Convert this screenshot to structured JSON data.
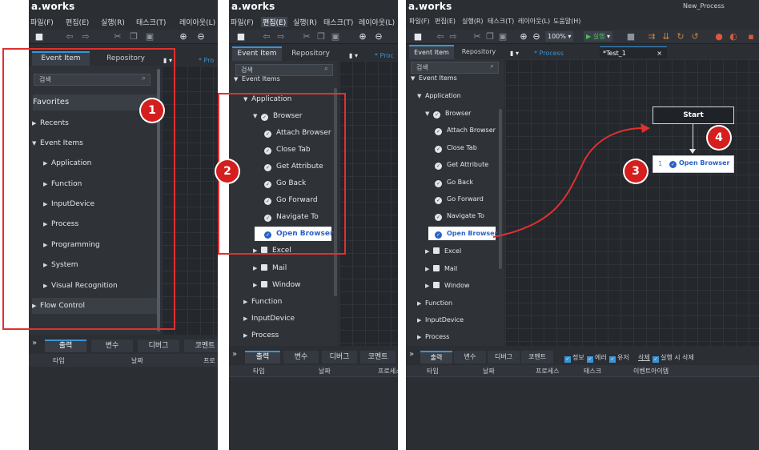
{
  "app": {
    "logo": "a.works",
    "window_title": "New_Process"
  },
  "menus": [
    "파일(F)",
    "편집(E)",
    "실행(R)",
    "태스크(T)",
    "레이아웃(L)",
    "도움말(H)"
  ],
  "toolbar": {
    "zoom": "100%",
    "run": "▶ 실행",
    "run_arrow": "▾"
  },
  "side_tabs": {
    "event_item": "Event Item",
    "repository": "Repository"
  },
  "search": {
    "placeholder": "검색",
    "icon": "search-icon"
  },
  "panel1_tree": {
    "favorites": "Favorites",
    "recents": "Recents",
    "event_items": "Event Items",
    "children": [
      "Application",
      "Function",
      "InputDevice",
      "Process",
      "Programming",
      "System",
      "Visual Recognition"
    ],
    "flow_control": "Flow Control"
  },
  "panel2_tree": {
    "event_items": "Event Items",
    "application": "Application",
    "browser": "Browser",
    "browser_items": [
      "Attach Browser",
      "Close Tab",
      "Get Attribute",
      "Go Back",
      "Go Forward",
      "Navigate To"
    ],
    "selected": "Open Browser",
    "after": [
      "Excel",
      "Mail",
      "Window"
    ],
    "roots": [
      "Function",
      "InputDevice",
      "Process"
    ]
  },
  "panel3_tree": {
    "event_items": "Event Items",
    "application": "Application",
    "browser": "Browser",
    "browser_items": [
      "Attach Browser",
      "Close Tab",
      "Get Attribute",
      "Go Back",
      "Go Forward",
      "Navigate To"
    ],
    "selected": "Open Browser",
    "after": [
      "Excel",
      "Mail",
      "Window"
    ],
    "roots": [
      "Function",
      "InputDevice",
      "Process"
    ]
  },
  "doc_tabs": {
    "process": "* Process",
    "process_short": "* Proc",
    "proc_short2": "* Pro",
    "test": "*Test_1",
    "close": "×"
  },
  "canvas": {
    "start_label": "Start",
    "activity_index": "1",
    "activity_label": "Open Browser"
  },
  "bottom": {
    "chevron": "»",
    "tabs": [
      "출력",
      "변수",
      "디버그",
      "코멘트"
    ],
    "columns": [
      "타입",
      "날짜",
      "프로세스",
      "태스크",
      "이벤트아이템"
    ],
    "columns_p1": [
      "타입",
      "날짜",
      "프로"
    ],
    "columns_p2": [
      "타입",
      "날짜",
      "프로세스"
    ],
    "tab_short": "코멘트",
    "filters": [
      "정보",
      "에러",
      "유저"
    ],
    "delete": "삭제",
    "delete_on_run": "실행 시 삭제"
  },
  "callouts": [
    "1",
    "2",
    "3",
    "4"
  ],
  "colors": {
    "accent": "#3a94d6",
    "callout": "#d51e1e",
    "highlight": "#e03030",
    "selected_text": "#2b62c8"
  }
}
